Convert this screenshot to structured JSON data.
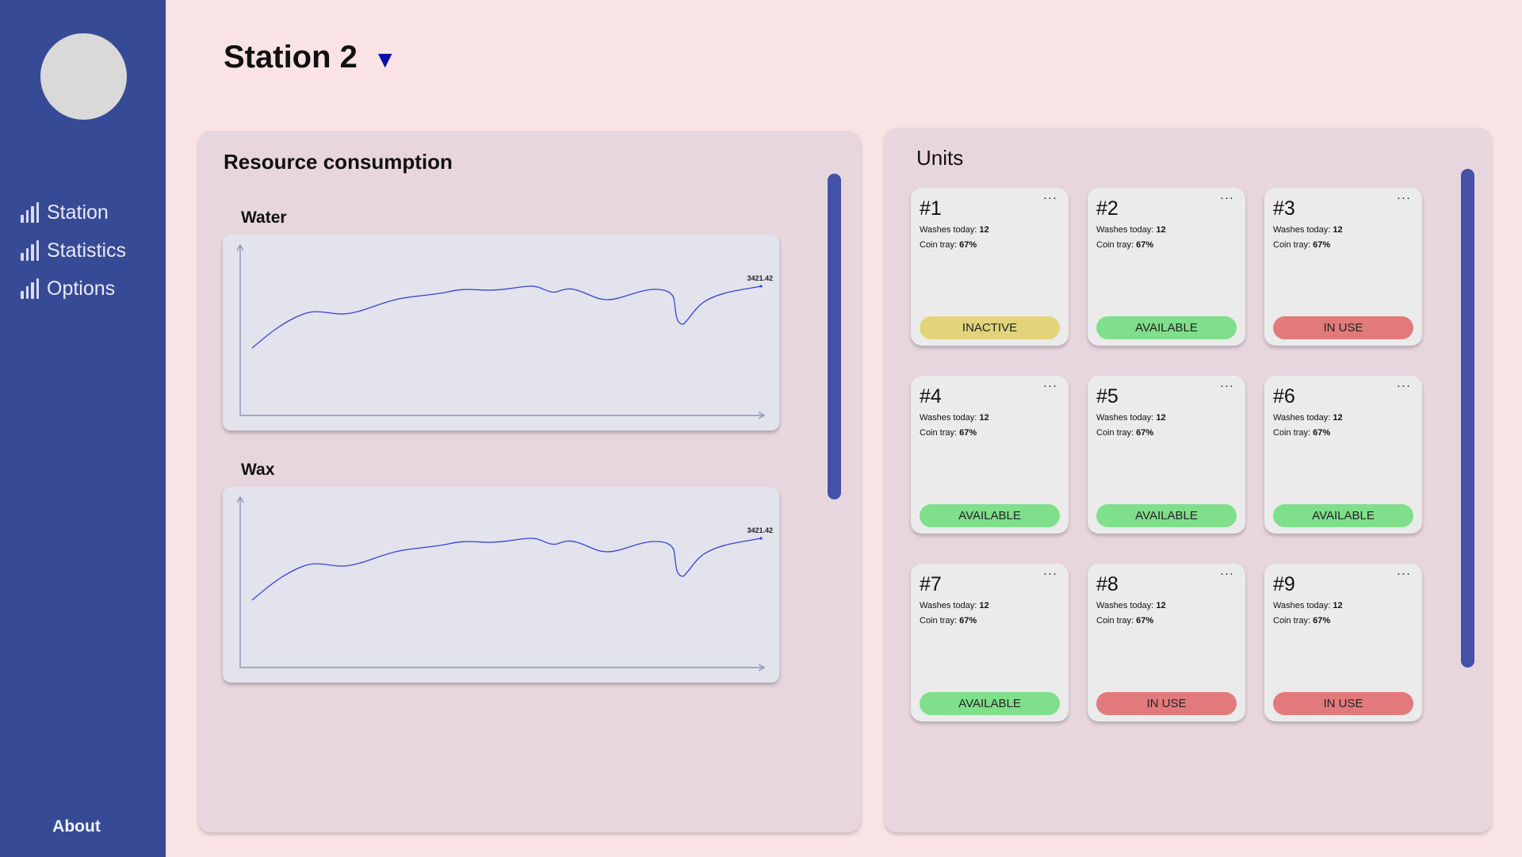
{
  "sidebar": {
    "nav": [
      {
        "label": "Station",
        "icon": "bar-chart-icon"
      },
      {
        "label": "Statistics",
        "icon": "bar-chart-icon"
      },
      {
        "label": "Options",
        "icon": "bar-chart-icon"
      }
    ],
    "about_label": "About"
  },
  "header": {
    "title": "Station 2",
    "dropdown_icon": "caret-down-icon"
  },
  "resource_panel": {
    "title": "Resource consumption",
    "charts": [
      {
        "label": "Water",
        "last_value_label": "3421.42"
      },
      {
        "label": "Wax",
        "last_value_label": "3421.42"
      }
    ]
  },
  "units_panel": {
    "title": "Units",
    "washes_label": "Washes today:",
    "coin_label": "Coin tray:",
    "units": [
      {
        "id": "#1",
        "washes": "12",
        "coin_tray": "67%",
        "status": "INACTIVE"
      },
      {
        "id": "#2",
        "washes": "12",
        "coin_tray": "67%",
        "status": "AVAILABLE"
      },
      {
        "id": "#3",
        "washes": "12",
        "coin_tray": "67%",
        "status": "IN USE"
      },
      {
        "id": "#4",
        "washes": "12",
        "coin_tray": "67%",
        "status": "AVAILABLE"
      },
      {
        "id": "#5",
        "washes": "12",
        "coin_tray": "67%",
        "status": "AVAILABLE"
      },
      {
        "id": "#6",
        "washes": "12",
        "coin_tray": "67%",
        "status": "AVAILABLE"
      },
      {
        "id": "#7",
        "washes": "12",
        "coin_tray": "67%",
        "status": "AVAILABLE"
      },
      {
        "id": "#8",
        "washes": "12",
        "coin_tray": "67%",
        "status": "IN USE"
      },
      {
        "id": "#9",
        "washes": "12",
        "coin_tray": "67%",
        "status": "IN USE"
      }
    ]
  },
  "status_colors": {
    "INACTIVE": "#e3d47a",
    "AVAILABLE": "#7fdf8a",
    "IN USE": "#e27a7c"
  },
  "colors": {
    "sidebar": "#374a95",
    "background": "#f9e3e5",
    "panel": "#e8d6df",
    "accent": "#4451a8",
    "chart_line": "#3644d6"
  }
}
